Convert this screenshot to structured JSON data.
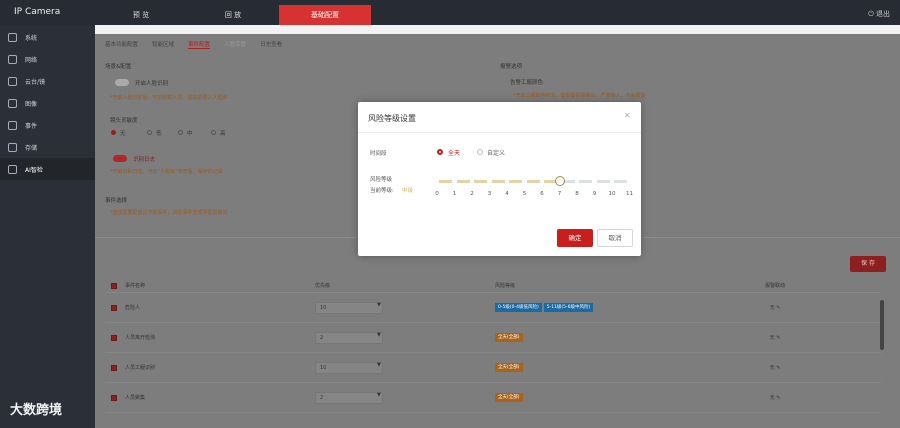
{
  "app": {
    "title": "IP Camera",
    "exit_label": "退出"
  },
  "topnav": [
    {
      "label": "预 览",
      "active": false
    },
    {
      "label": "回 放",
      "active": false
    },
    {
      "label": "基础配置",
      "active": true
    }
  ],
  "sidebar": [
    {
      "label": "系统",
      "icon": "gear-icon",
      "active": false
    },
    {
      "label": "网络",
      "icon": "globe-icon",
      "active": false
    },
    {
      "label": "云台/镜",
      "icon": "ptz-icon",
      "active": false
    },
    {
      "label": "图像",
      "icon": "image-icon",
      "active": false
    },
    {
      "label": "事件",
      "icon": "event-icon",
      "active": false
    },
    {
      "label": "存储",
      "icon": "storage-icon",
      "active": false
    },
    {
      "label": "AI智检",
      "icon": "ai-icon",
      "active": true
    }
  ],
  "tabs": [
    {
      "label": "基本功能配置",
      "state": "normal"
    },
    {
      "label": "智能区域",
      "state": "normal"
    },
    {
      "label": "事件配置",
      "state": "active"
    },
    {
      "label": "人脸库管",
      "state": "dim"
    },
    {
      "label": "日志查看",
      "state": "normal"
    }
  ],
  "config": {
    "scene_title": "场景&配置",
    "face_recognition_label": "开启人脸识别",
    "face_hint": "*开启人脸识别后，可识别的人员，需提前录入人脸库",
    "sensitivity_title": "镜头灵敏度",
    "sensitivity_options": [
      "无",
      "低",
      "中",
      "高"
    ],
    "sensitivity_selected": 0,
    "recognize_label": "识别日志",
    "recognize_hint": "*开启识别日志，可在“人脸库”中查看，保存的记录",
    "event_title": "事件选择",
    "event_hint": "*选择需要配置以下的事件，请在事件选项中配置联动",
    "alarm_title": "报警选项",
    "alarm_sub": "告警工服颜色",
    "alarm_hint": "*开启工服颜色检测，需配置报警联动，严重输入，不会报警"
  },
  "save_label": "保 存",
  "table": {
    "headers": [
      "事件名称",
      "优先级",
      "风险等级",
      "报警联动"
    ],
    "rows": [
      {
        "name": "危险人",
        "priority": "10",
        "risks": [
          "0-5级(0-4级低风险)",
          "5-11级(5-6级中风险)"
        ],
        "risk_color": "blue",
        "link": "无"
      },
      {
        "name": "人员离开检测",
        "priority": "2",
        "risks": [
          "全天(全部)"
        ],
        "risk_color": "orange",
        "link": "无"
      },
      {
        "name": "人员工服识别",
        "priority": "10",
        "risks": [
          "全天(全部)"
        ],
        "risk_color": "orange",
        "link": "无"
      },
      {
        "name": "人员聚集",
        "priority": "2",
        "risks": [
          "全天(全部)"
        ],
        "risk_color": "orange",
        "link": "无"
      }
    ]
  },
  "watermark": "大数跨境",
  "modal": {
    "title": "风险等级设置",
    "time_label": "时间段",
    "time_options": [
      "全天",
      "自定义"
    ],
    "time_selected": 0,
    "risk_label": "风险等级",
    "current_label": "当前等级:",
    "current_value": "中级",
    "ticks": [
      "0",
      "1",
      "2",
      "3",
      "4",
      "5",
      "6",
      "7",
      "8",
      "9",
      "10",
      "11"
    ],
    "level": 7,
    "ok_label": "确定",
    "cancel_label": "取消",
    "close_icon": "close-icon"
  }
}
